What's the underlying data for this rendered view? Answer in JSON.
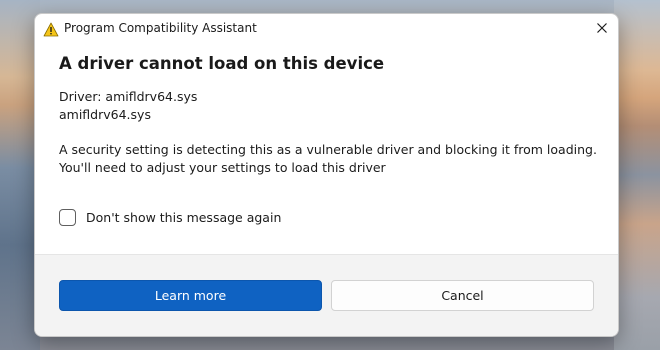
{
  "window": {
    "title": "Program Compatibility Assistant",
    "title_icon": "warning-icon",
    "close_icon": "close-icon"
  },
  "message": {
    "heading": "A driver cannot load on this device",
    "driver_line1": "Driver: amifldrv64.sys",
    "driver_line2": "amifldrv64.sys",
    "description_line1": "A security setting is detecting this as a vulnerable driver and blocking it from loading.",
    "description_line2": "You'll need to adjust your settings to load this driver"
  },
  "checkbox": {
    "label": "Don't show this message again",
    "checked": false
  },
  "buttons": {
    "learn_more": "Learn more",
    "cancel": "Cancel"
  },
  "colors": {
    "accent": "#0f62c2",
    "warning": "#f5c518"
  }
}
